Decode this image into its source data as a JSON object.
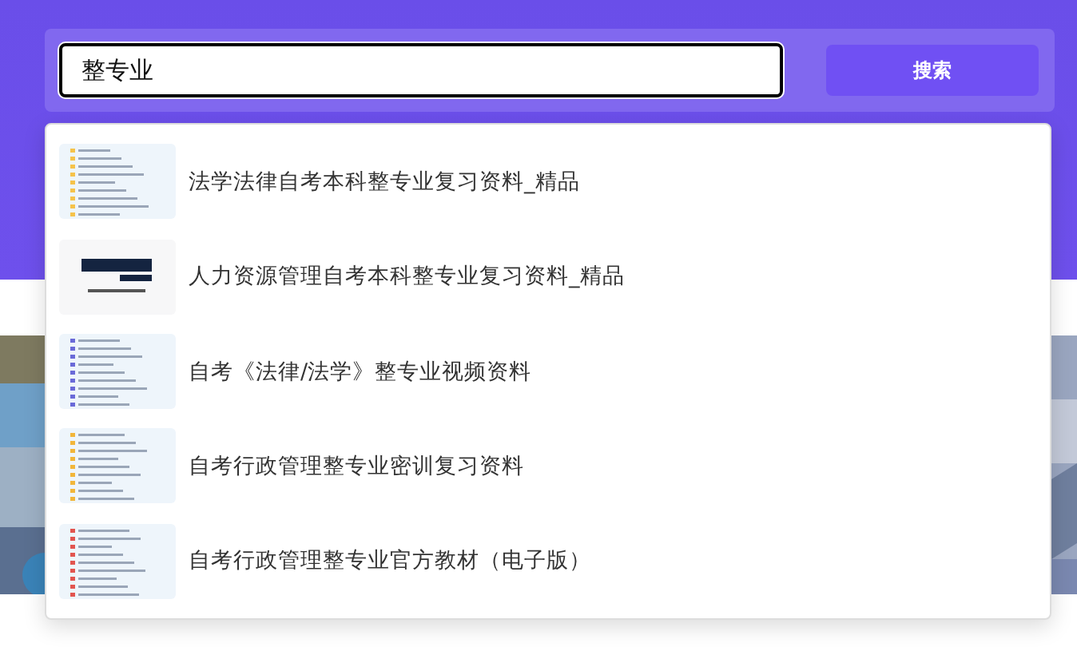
{
  "search": {
    "value": "整专业",
    "button": "搜索"
  },
  "suggestions": [
    {
      "title": "法学法律自考本科整专业复习资料_精品"
    },
    {
      "title": "人力资源管理自考本科整专业复习资料_精品"
    },
    {
      "title": "自考《法律/法学》整专业视频资料"
    },
    {
      "title": "自考行政管理整专业密训复习资料"
    },
    {
      "title": "自考行政管理整专业官方教材（电子版）"
    }
  ]
}
